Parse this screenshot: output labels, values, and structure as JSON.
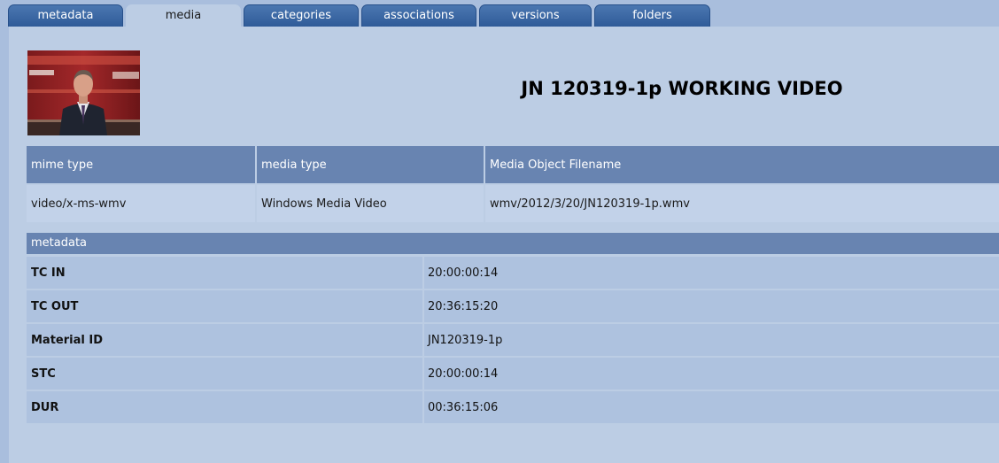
{
  "tabs": [
    {
      "label": "metadata",
      "active": false
    },
    {
      "label": "media",
      "active": true
    },
    {
      "label": "categories",
      "active": false
    },
    {
      "label": "associations",
      "active": false
    },
    {
      "label": "versions",
      "active": false
    },
    {
      "label": "folders",
      "active": false
    }
  ],
  "media": {
    "title": "JN 120319-1p WORKING VIDEO",
    "headers": {
      "mime_type": "mime type",
      "media_type": "media type",
      "filename": "Media Object Filename"
    },
    "values": {
      "mime_type": "video/x-ms-wmv",
      "media_type": "Windows Media Video",
      "filename": "wmv/2012/3/20/JN120319-1p.wmv"
    }
  },
  "metadata": {
    "section_label": "metadata",
    "rows": [
      {
        "key": "TC IN",
        "value": "20:00:00:14"
      },
      {
        "key": "TC OUT",
        "value": "20:36:15:20"
      },
      {
        "key": "Material ID",
        "value": "JN120319-1p"
      },
      {
        "key": "STC",
        "value": "20:00:00:14"
      },
      {
        "key": "DUR",
        "value": "00:36:15:06"
      }
    ]
  },
  "colors": {
    "tab": "#2f5b98",
    "header": "#6884b1",
    "background": "#bccde4"
  }
}
